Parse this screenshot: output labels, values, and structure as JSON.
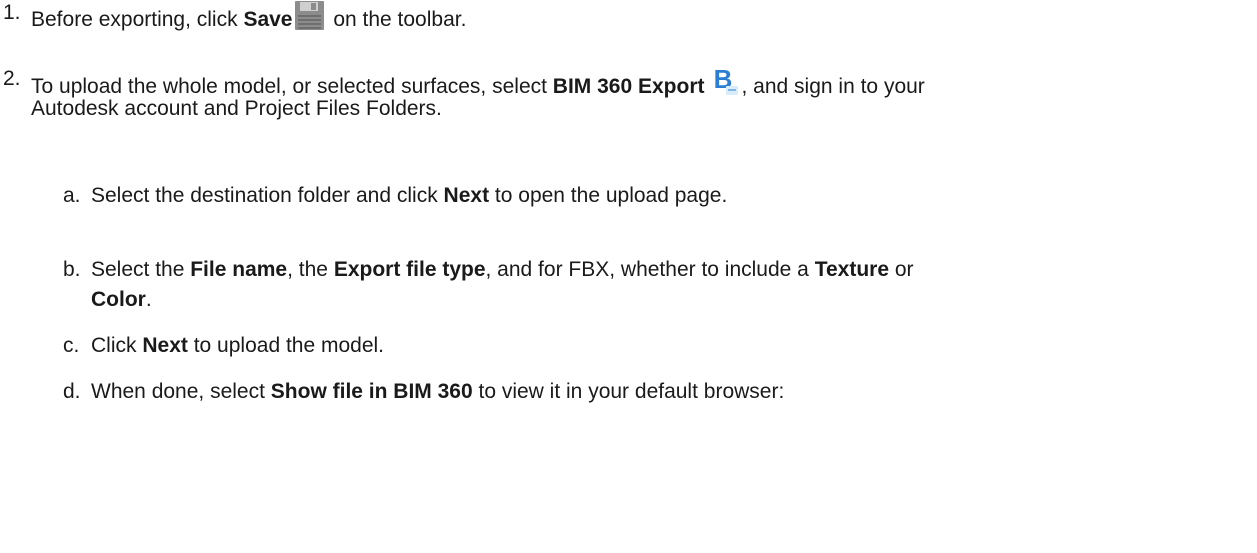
{
  "steps": [
    {
      "number": "1.",
      "text1": "Before exporting, click ",
      "bold1": "Save",
      "icon": "save-disk-icon",
      "text2": " on the toolbar."
    },
    {
      "number": "2.",
      "line1_text1": "To upload the whole model, or selected surfaces, select ",
      "line1_bold1": "BIM 360 Export",
      "icon": "bim360-icon",
      "line1_text2": ", and sign in to your",
      "line2": "Autodesk account and Project Files Folders."
    }
  ],
  "substeps": [
    {
      "letter": "a.",
      "text1": "Select the destination folder and click ",
      "bold1": "Next",
      "text2": " to open the upload page."
    },
    {
      "letter": "b.",
      "text1": "Select the ",
      "bold1": "File name",
      "text2": ", the ",
      "bold2": "Export file type",
      "text3": ", and for FBX, whether to include a ",
      "bold3": "Texture",
      "text4": " or",
      "line2_bold": "Color",
      "line2_text": "."
    },
    {
      "letter": "c.",
      "text1": "Click ",
      "bold1": "Next",
      "text2": " to upload the model."
    },
    {
      "letter": "d.",
      "text1": "When done, select ",
      "bold1": "Show file in BIM 360",
      "text2": " to view it in your default browser:"
    }
  ],
  "colors": {
    "text": "#1a1a1a",
    "save_icon": "#8a8a8a",
    "bim_blue": "#2a7fd4",
    "bim_badge_bg": "#d8ecf9"
  }
}
